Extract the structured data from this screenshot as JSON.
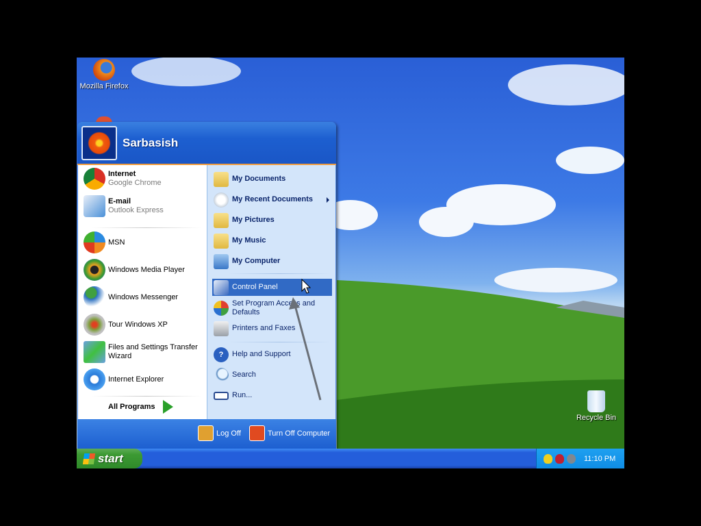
{
  "desktop": {
    "icons": [
      {
        "label": "Mozilla Firefox",
        "icon": "firefox-icon"
      },
      {
        "label": "Recycle Bin",
        "icon": "recycle-bin-icon"
      }
    ]
  },
  "start_menu": {
    "user_name": "Sarbasish",
    "pinned": [
      {
        "title": "Internet",
        "subtitle": "Google Chrome"
      },
      {
        "title": "E-mail",
        "subtitle": "Outlook Express"
      }
    ],
    "recent": [
      "MSN",
      "Windows Media Player",
      "Windows Messenger",
      "Tour Windows XP",
      "Files and Settings Transfer Wizard",
      "Internet Explorer"
    ],
    "all_programs": "All Programs",
    "places": [
      "My Documents",
      "My Recent Documents",
      "My Pictures",
      "My Music",
      "My Computer"
    ],
    "settings": [
      "Control Panel",
      "Set Program Access and Defaults",
      "Printers and Faxes"
    ],
    "tools": [
      "Help and Support",
      "Search",
      "Run..."
    ],
    "selected": "Control Panel",
    "log_off": "Log Off",
    "turn_off": "Turn Off Computer"
  },
  "taskbar": {
    "start_label": "start",
    "clock": "11:10 PM"
  },
  "colors": {
    "selection": "#316ac5",
    "taskbar": "#245edb",
    "start_green": "#3c9a33"
  }
}
